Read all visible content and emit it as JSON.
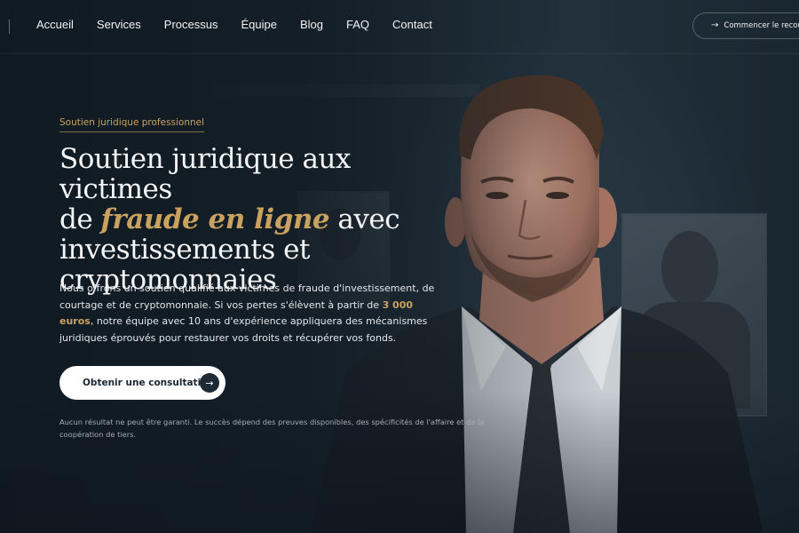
{
  "nav": {
    "links": [
      {
        "label": "Accueil"
      },
      {
        "label": "Services"
      },
      {
        "label": "Processus"
      },
      {
        "label": "Équipe"
      },
      {
        "label": "Blog"
      },
      {
        "label": "FAQ"
      },
      {
        "label": "Contact"
      }
    ],
    "cta_label": "Commencer le recouv",
    "cta_icon": "arrow-right-icon"
  },
  "hero": {
    "eyebrow": "Soutien juridique professionnel",
    "title": {
      "line1": "Soutien juridique aux victimes",
      "line2_prefix": "de ",
      "line2_accent": "fraude en ligne",
      "line2_suffix": " avec",
      "line3": "investissements et",
      "line4": "cryptomonnaies"
    },
    "description": {
      "part1": "Nous offrons un soutien qualifié aux victimes de fraude d'investissement, de courtage et de cryptomonnaie. Si vos pertes s'élèvent à partir de ",
      "amount": "3 000 euros",
      "part2": ", notre équipe avec 10 ans d'expérience appliquera des mécanismes juridiques éprouvés pour restaurer vos droits et récupérer vos fonds."
    },
    "cta_label": "Obtenir une consultation",
    "cta_icon": "arrow-right-icon",
    "disclaimer": "Aucun résultat ne peut être garanti. Le succès dépend des preuves disponibles, des spécificités de l'affaire et de la coopération de tiers."
  },
  "colors": {
    "accent_gold": "#c9a25f",
    "background": "#1a2530",
    "button_bg": "#ffffff"
  }
}
